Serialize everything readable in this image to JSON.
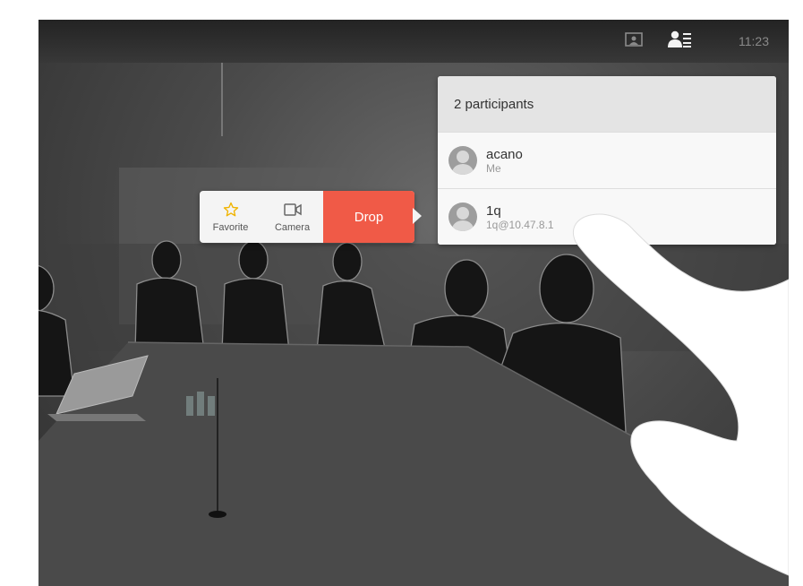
{
  "status_bar": {
    "time": "11:23",
    "icons": [
      "self-view-icon",
      "participants-icon"
    ]
  },
  "participants_panel": {
    "title": "2 participants",
    "participants": [
      {
        "name": "acano",
        "detail": "Me"
      },
      {
        "name": "1q",
        "detail": "1q@10.47.8.1"
      }
    ]
  },
  "participant_menu": {
    "favorite_label": "Favorite",
    "camera_label": "Camera",
    "drop_label": "Drop",
    "colors": {
      "drop": "#f05a47",
      "favorite_star": "#f0b400"
    }
  }
}
